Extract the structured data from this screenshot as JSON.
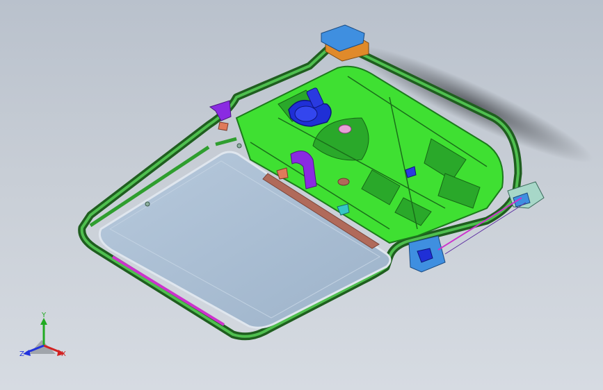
{
  "viewer": {
    "background_top": "#b9c1cc",
    "background_bottom": "#d6dbe2"
  },
  "model": {
    "frame_color": "#2e8b2e",
    "inner_panel_color": "#36e02a",
    "glass_color": "#a9bdd2",
    "seal_color": "#cc33cc",
    "motor_color": "#1f2fd6",
    "bracket_color": "#8a2be2",
    "rail_color": "#b06a5a",
    "blue_part_color": "#3f8fe0",
    "orange_part_color": "#e08a2a"
  },
  "triad": {
    "y_label": "Y",
    "x_label": "X",
    "z_label": "Z",
    "y_color": "#22aa22",
    "x_color": "#d22222",
    "z_color": "#2233dd"
  }
}
